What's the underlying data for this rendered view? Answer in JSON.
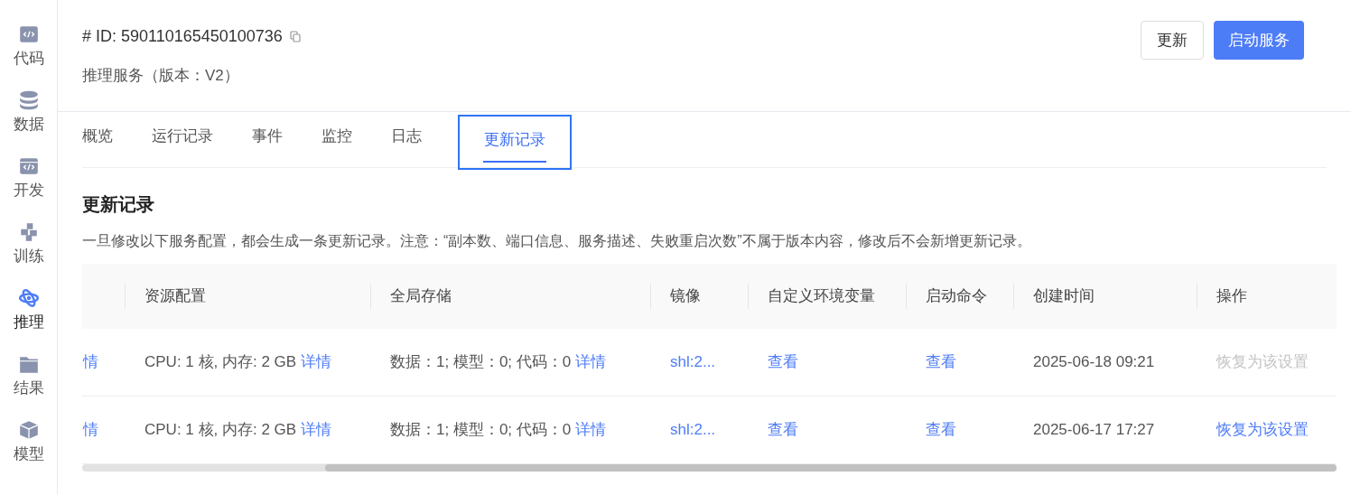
{
  "sidebar": {
    "items": [
      {
        "label": "代码",
        "selected": false
      },
      {
        "label": "数据",
        "selected": false
      },
      {
        "label": "开发",
        "selected": false
      },
      {
        "label": "训练",
        "selected": false
      },
      {
        "label": "推理",
        "selected": true
      },
      {
        "label": "结果",
        "selected": false
      },
      {
        "label": "模型",
        "selected": false
      }
    ]
  },
  "header": {
    "id": "# ID: 590110165450100736",
    "subtitle": "推理服务（版本：V2）",
    "buttons": [
      {
        "label": "更新",
        "kind": "default"
      },
      {
        "label": "启动服务",
        "kind": "primary"
      }
    ]
  },
  "tabs": [
    {
      "label": "概览",
      "selected": false
    },
    {
      "label": "运行记录",
      "selected": false
    },
    {
      "label": "事件",
      "selected": false
    },
    {
      "label": "监控",
      "selected": false
    },
    {
      "label": "日志",
      "selected": false
    },
    {
      "label": "更新记录",
      "selected": true
    }
  ],
  "section": {
    "title": "更新记录",
    "notice": "一旦修改以下服务配置，都会生成一条更新记录。注意：“副本数、端口信息、服务描述、失败重启次数”不属于版本内容，修改后不会新增更新记录。"
  },
  "table": {
    "columns": [
      "",
      "资源配置",
      "全局存储",
      "镜像",
      "自定义环境变量",
      "启动命令",
      "创建时间",
      "操作"
    ],
    "rows": [
      {
        "column_1": "情",
        "resources": "CPU: 1 核, 内存: 2 GB",
        "resources_link": "详情",
        "storage": "数据：1; 模型：0; 代码：0",
        "storage_link": "详情",
        "image": "shl:2...",
        "env": "查看",
        "command": "查看",
        "created": "2025-06-18 09:21",
        "action": "恢复为该设置",
        "disabled": true
      },
      {
        "column_1": "情",
        "resources": "CPU: 1 核, 内存: 2 GB",
        "resources_link": "详情",
        "storage": "数据：1; 模型：0; 代码：0",
        "storage_link": "详情",
        "image": "shl:2...",
        "env": "查看",
        "command": "查看",
        "created": "2025-06-17 17:27",
        "action": "恢复为该设置",
        "disabled": false
      }
    ]
  }
}
